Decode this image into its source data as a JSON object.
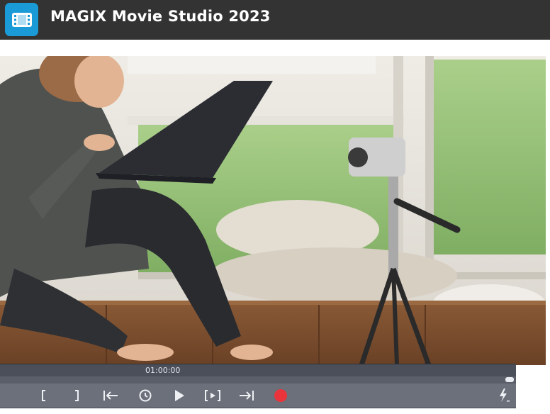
{
  "app": {
    "title": "MAGIX Movie Studio 2023",
    "icon": "film-icon",
    "accent_color": "#1a9bd7"
  },
  "preview": {
    "content": "video-frame"
  },
  "transport": {
    "timecode": "01:00:00",
    "playhead_position": 0.99,
    "buttons": [
      {
        "name": "mark-in-button",
        "icon": "bracket-left-icon"
      },
      {
        "name": "mark-out-button",
        "icon": "bracket-right-icon"
      },
      {
        "name": "go-to-start-button",
        "icon": "arrow-to-start-icon"
      },
      {
        "name": "loop-button",
        "icon": "loop-icon"
      },
      {
        "name": "play-button",
        "icon": "play-icon"
      },
      {
        "name": "play-range-button",
        "icon": "play-range-icon"
      },
      {
        "name": "go-to-end-button",
        "icon": "arrow-to-end-icon"
      },
      {
        "name": "record-button",
        "icon": "record-icon",
        "color": "#e8343a"
      },
      {
        "name": "shuttle-button",
        "icon": "lightning-icon"
      }
    ]
  }
}
